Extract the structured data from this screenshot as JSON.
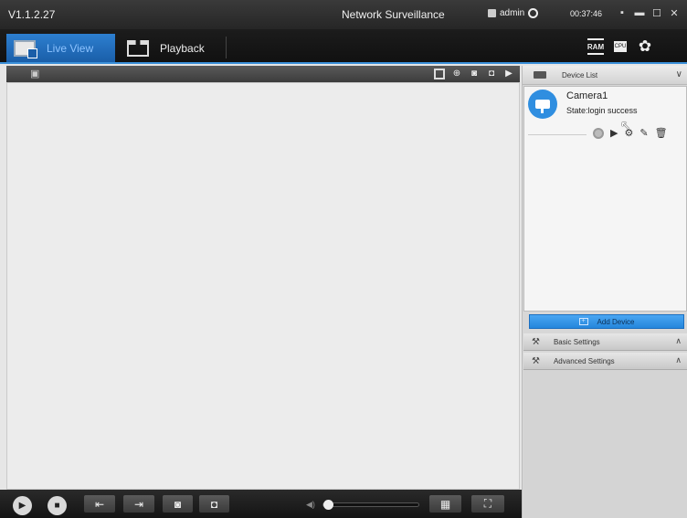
{
  "titlebar": {
    "version": "V1.1.2.27",
    "title": "Network Surveillance",
    "user": "admin",
    "clock": "00:37:46"
  },
  "tabs": {
    "live_view": "Live View",
    "playback": "Playback"
  },
  "topright": {
    "ram_label": "RAM",
    "cpu_label": "CPU"
  },
  "device_list": {
    "header": "Device List",
    "cameras": [
      {
        "name": "Camera1",
        "state": "State:login success"
      }
    ]
  },
  "add_device": {
    "label": "Add Device"
  },
  "sections": {
    "basic": "Basic Settings",
    "advanced": "Advanced Settings"
  },
  "volume": {
    "level": 0
  },
  "colors": {
    "accent": "#2f8ee0",
    "titlebar": "#262626",
    "tab_active": "#1a5ea8",
    "panel_bg": "#d7d7d7"
  },
  "icons": [
    "user-icon",
    "globe-icon",
    "monitor-icon",
    "clapperboard-icon",
    "ram-icon",
    "cpu-icon",
    "gear-icon",
    "fullscreen-icon",
    "zoom-icon",
    "snapshot-icon",
    "record-icon",
    "play-icon",
    "camera-icon",
    "trash-icon",
    "edit-icon",
    "settings-icon"
  ]
}
